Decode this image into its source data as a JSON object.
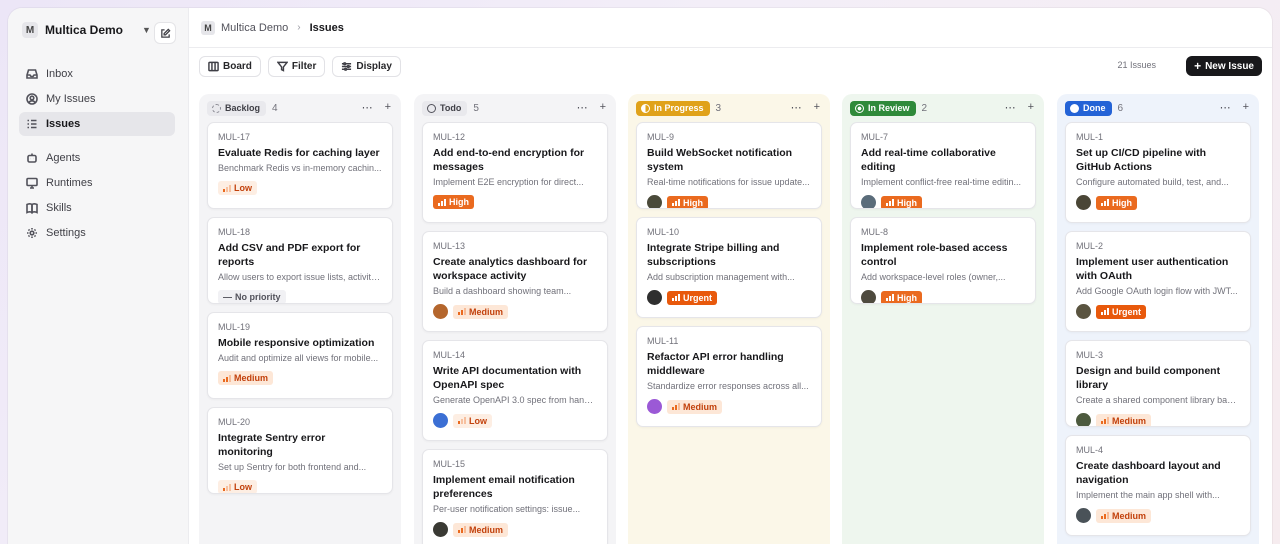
{
  "workspace": {
    "badge": "M",
    "name": "Multica Demo"
  },
  "nav": {
    "group1": [
      {
        "label": "Inbox",
        "icon": "inbox-icon"
      },
      {
        "label": "My Issues",
        "icon": "user-circle-icon"
      },
      {
        "label": "Issues",
        "icon": "list-icon",
        "active": true
      }
    ],
    "group2": [
      {
        "label": "Agents",
        "icon": "agents-icon"
      },
      {
        "label": "Runtimes",
        "icon": "monitor-icon"
      },
      {
        "label": "Skills",
        "icon": "book-icon"
      },
      {
        "label": "Settings",
        "icon": "gear-icon"
      }
    ]
  },
  "breadcrumb": {
    "badge": "M",
    "workspace": "Multica Demo",
    "current": "Issues"
  },
  "toolbar": {
    "board": "Board",
    "filter": "Filter",
    "display": "Display",
    "count": "21 Issues",
    "new_issue": "New Issue"
  },
  "columns": [
    {
      "status": "Backlog",
      "count": "4",
      "bg": "#f4f4f6",
      "pill_bg": "#e9e9ed",
      "pill_fg": "#3f3f46",
      "cards": [
        {
          "id": "MUL-17",
          "title": "Evaluate Redis for caching layer",
          "desc": "Benchmark Redis vs in-memory cachin...",
          "priority": "Low"
        },
        {
          "id": "MUL-18",
          "title": "Add CSV and PDF export for reports",
          "desc": "Allow users to export issue lists, activity...",
          "priority": "No priority"
        },
        {
          "id": "MUL-19",
          "title": "Mobile responsive optimization",
          "desc": "Audit and optimize all views for mobile...",
          "priority": "Medium"
        },
        {
          "id": "MUL-20",
          "title": "Integrate Sentry error monitoring",
          "desc": "Set up Sentry for both frontend and...",
          "priority": "Low"
        }
      ]
    },
    {
      "status": "Todo",
      "count": "5",
      "bg": "#f4f4f6",
      "pill_bg": "#e9e9ed",
      "pill_fg": "#3f3f46",
      "cards": [
        {
          "id": "MUL-12",
          "title": "Add end-to-end encryption for messages",
          "desc": "Implement E2E encryption for direct...",
          "priority": "High"
        },
        {
          "id": "MUL-13",
          "title": "Create analytics dashboard for workspace activity",
          "desc": "Build a dashboard showing team...",
          "priority": "Medium",
          "avatar": "#b4662d"
        },
        {
          "id": "MUL-14",
          "title": "Write API documentation with OpenAPI spec",
          "desc": "Generate OpenAPI 3.0 spec from handl...",
          "priority": "Low",
          "avatar": "#3b6fd4"
        },
        {
          "id": "MUL-15",
          "title": "Implement email notification preferences",
          "desc": "Per-user notification settings: issue...",
          "priority": "Medium",
          "avatar": "#3a3a34"
        }
      ]
    },
    {
      "status": "In Progress",
      "count": "3",
      "bg": "#fbf7e8",
      "pill_bg": "#e0a21a",
      "pill_fg": "#ffffff",
      "cards": [
        {
          "id": "MUL-9",
          "title": "Build WebSocket notification system",
          "desc": "Real-time notifications for issue update...",
          "priority": "High",
          "avatar": "#4a4a3a"
        },
        {
          "id": "MUL-10",
          "title": "Integrate Stripe billing and subscriptions",
          "desc": "Add subscription management with...",
          "priority": "Urgent",
          "avatar": "#2f2f2f"
        },
        {
          "id": "MUL-11",
          "title": "Refactor API error handling middleware",
          "desc": "Standardize error responses across all...",
          "priority": "Medium",
          "avatar": "#9b59d6"
        }
      ]
    },
    {
      "status": "In Review",
      "count": "2",
      "bg": "#eef6ee",
      "pill_bg": "#2f8a3a",
      "pill_fg": "#ffffff",
      "cards": [
        {
          "id": "MUL-7",
          "title": "Add real-time collaborative editing",
          "desc": "Implement conflict-free real-time editin...",
          "priority": "High",
          "avatar": "#5a6c7a"
        },
        {
          "id": "MUL-8",
          "title": "Implement role-based access control",
          "desc": "Add workspace-level roles (owner,...",
          "priority": "High",
          "avatar": "#4e4a3e"
        }
      ]
    },
    {
      "status": "Done",
      "count": "6",
      "bg": "#eef3fb",
      "pill_bg": "#2463d6",
      "pill_fg": "#ffffff",
      "cards": [
        {
          "id": "MUL-1",
          "title": "Set up CI/CD pipeline with GitHub Actions",
          "desc": "Configure automated build, test, and...",
          "priority": "High",
          "avatar": "#4a4636"
        },
        {
          "id": "MUL-2",
          "title": "Implement user authentication with OAuth",
          "desc": "Add Google OAuth login flow with JWT...",
          "priority": "Urgent",
          "avatar": "#5a5440"
        },
        {
          "id": "MUL-3",
          "title": "Design and build component library",
          "desc": "Create a shared component library base...",
          "priority": "Medium",
          "avatar": "#4d5a3e"
        },
        {
          "id": "MUL-4",
          "title": "Create dashboard layout and navigation",
          "desc": "Implement the main app shell with...",
          "priority": "Medium",
          "avatar": "#4a5258"
        }
      ]
    }
  ]
}
